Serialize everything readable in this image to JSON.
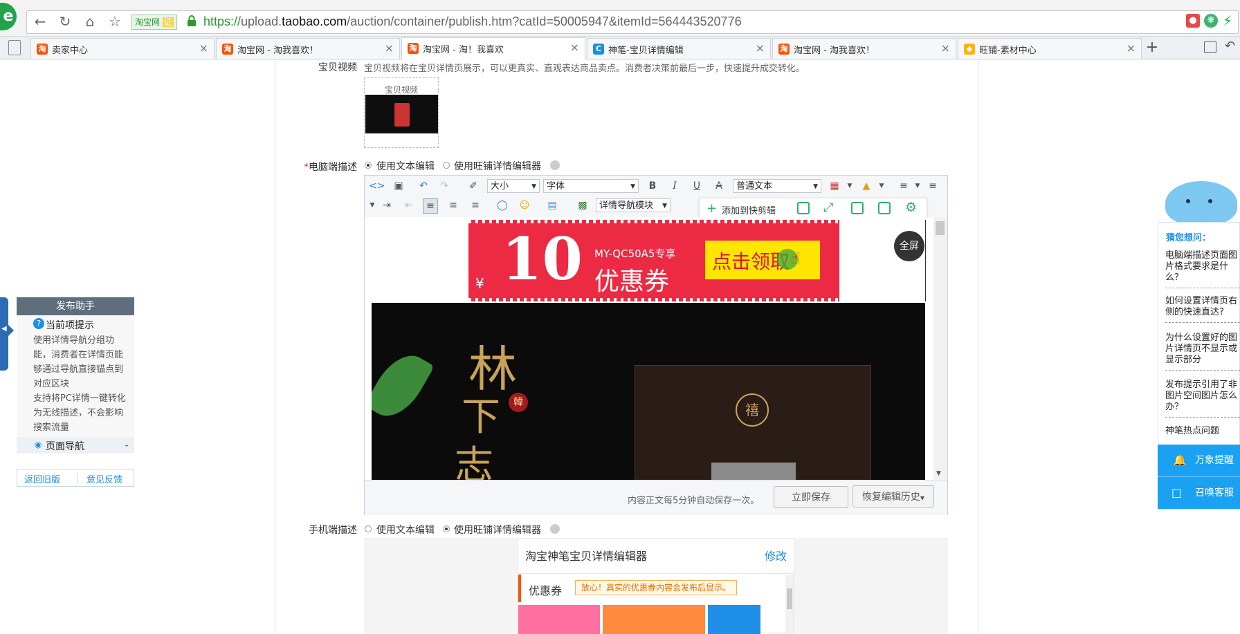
{
  "browser": {
    "logo_glyph": "e",
    "site_badge": "淘宝网",
    "site_badge_verified": "证",
    "url_scheme": "https://",
    "url_subdomain": "upload.",
    "url_domain": "taobao.com",
    "url_path": "/auction/container/publish.htm?catId=50005947&itemId=564443520776",
    "new_tab": "+"
  },
  "tabs": [
    {
      "label": "卖家中心",
      "icon": "taobao-favicon",
      "active": false
    },
    {
      "label": "淘宝网 - 淘我喜欢！",
      "icon": "taobao-favicon",
      "active": false
    },
    {
      "label": "淘宝网 - 淘！我喜欢",
      "icon": "taobao-favicon",
      "active": true
    },
    {
      "label": "神笔-宝贝详情编辑",
      "icon": "shenbi-favicon",
      "active": false
    },
    {
      "label": "淘宝网 - 淘我喜欢！",
      "icon": "taobao-favicon",
      "active": false
    },
    {
      "label": "旺铺-素材中心",
      "icon": "wangpu-favicon",
      "active": false
    }
  ],
  "video_section": {
    "label": "宝贝视频",
    "description": "宝贝视频将在宝贝详情页展示，可以更真实、直观表达商品卖点。消费者决策前最后一步，快速提升成交转化。",
    "thumb_caption": "宝贝视频"
  },
  "pc_desc": {
    "required_mark": "*",
    "label": "电脑端描述",
    "option_text": "使用文本编辑",
    "option_wangpu": "使用旺铺详情编辑器",
    "selected": "使用文本编辑"
  },
  "editor": {
    "font_size_select": "大小",
    "font_family_select": "字体",
    "paragraph_select": "普通文本",
    "nav_module_select": "详情导航模块",
    "quick_add": "添加到快剪辑",
    "fullscreen": "全屏",
    "autosave_note": "内容正文每5分钟自动保存一次。",
    "save_now": "立即保存",
    "restore_history": "恢复编辑历史"
  },
  "coupon_banner": {
    "currency": "¥",
    "amount": "10",
    "code_line": "MY-QC50A5专享",
    "coupon_word": "优惠券",
    "cta": "点击领取"
  },
  "product_image": {
    "calligraphy_1": "林",
    "calligraphy_2": "下",
    "calligraphy_3": "志",
    "seal": "韓",
    "box_emblem": "禧"
  },
  "mobile_desc": {
    "label": "手机端描述",
    "option_text": "使用文本编辑",
    "option_wangpu": "使用旺铺详情编辑器",
    "selected": "使用旺铺详情编辑器",
    "preview_title": "淘宝神笔宝贝详情编辑器",
    "edit_link": "修改",
    "coupon_label": "优惠券",
    "coupon_notice": "放心！真实的优惠券内容会发布后显示。"
  },
  "helper": {
    "title": "发布助手",
    "current_tip": "当前项提示",
    "tip_text_1": "使用详情导航分组功能，消费者在详情页能够通过导航直接锚点到对应区块",
    "tip_text_2": "支持将PC详情一键转化为无线描述，不会影响搜索流量",
    "page_nav": "页面导航",
    "back_old": "返回旧版",
    "feedback": "意见反馈"
  },
  "guess_panel": {
    "title": "猜您想问：",
    "questions": [
      "电脑端描述页面图片格式要求是什么？",
      "如何设置详情页右侧的快速直达?",
      "为什么设置好的图片详情页不显示或显示部分",
      "发布提示引用了非图片空间图片怎么办？",
      "神笔热点问题"
    ],
    "reminder": "万象提醒",
    "call_service": "召唤客服"
  },
  "colors": {
    "accent_green": "#22a34b",
    "taobao_orange": "#ff5000",
    "coupon_red": "#ec2a43",
    "link_blue": "#1a8fe3",
    "panel_blue": "#1aa1f1"
  }
}
